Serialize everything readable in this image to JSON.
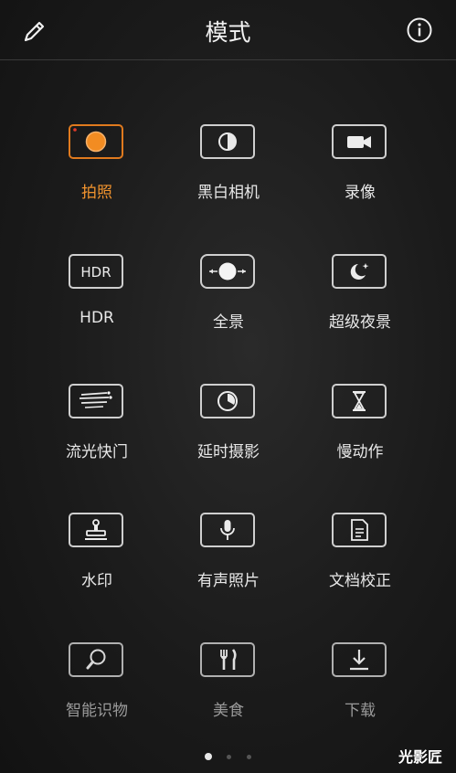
{
  "header": {
    "title": "模式",
    "left_icon": "edit-pencil-icon",
    "right_icon": "info-icon"
  },
  "modes": [
    {
      "label": "拍照",
      "icon": "photo-icon",
      "active": true
    },
    {
      "label": "黑白相机",
      "icon": "monochrome-icon"
    },
    {
      "label": "录像",
      "icon": "video-icon"
    },
    {
      "label": "HDR",
      "icon": "hdr-icon",
      "icon_text": "HDR"
    },
    {
      "label": "全景",
      "icon": "panorama-icon"
    },
    {
      "label": "超级夜景",
      "icon": "night-mode-icon"
    },
    {
      "label": "流光快门",
      "icon": "light-painting-icon"
    },
    {
      "label": "延时摄影",
      "icon": "time-lapse-icon"
    },
    {
      "label": "慢动作",
      "icon": "slow-motion-icon"
    },
    {
      "label": "水印",
      "icon": "watermark-stamp-icon"
    },
    {
      "label": "有声照片",
      "icon": "audio-photo-icon"
    },
    {
      "label": "文档校正",
      "icon": "document-scan-icon"
    },
    {
      "label": "智能识物",
      "icon": "object-recognition-icon"
    },
    {
      "label": "美食",
      "icon": "food-icon"
    },
    {
      "label": "下载",
      "icon": "download-icon"
    }
  ],
  "pagination": {
    "pages": 3,
    "current": 1
  },
  "watermark": "光影匠",
  "colors": {
    "accent": "#f0932e",
    "active_border": "#e07a1e"
  }
}
